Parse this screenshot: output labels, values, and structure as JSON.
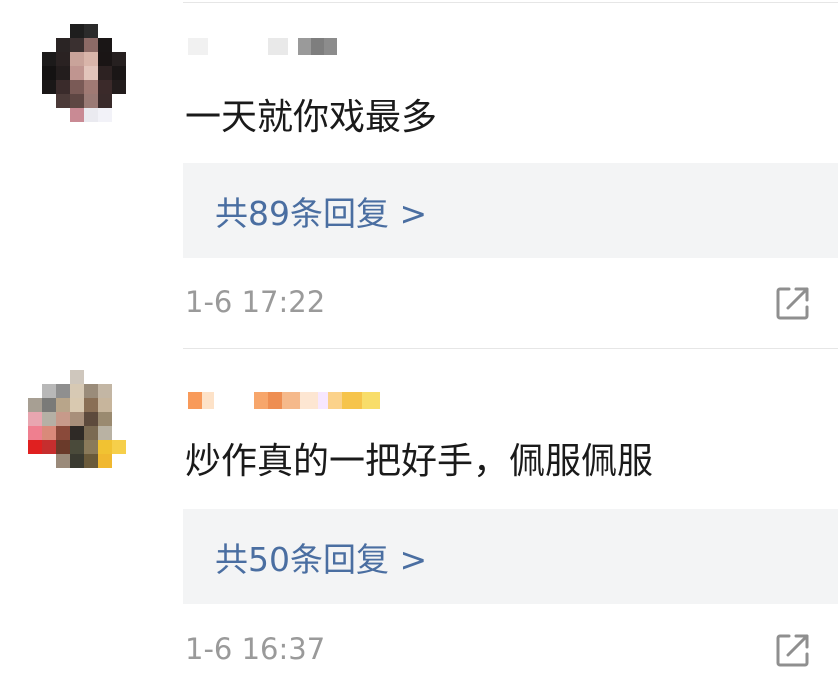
{
  "comments": [
    {
      "text": "一天就你戏最多",
      "reply_label": "共89条回复 >",
      "timestamp": "1-6 17:22",
      "avatar_icon": "pixelated-avatar-icon",
      "share_icon": "share-external-icon"
    },
    {
      "text": "炒作真的一把好手，佩服佩服",
      "reply_label": "共50条回复 >",
      "timestamp": "1-6 16:37",
      "avatar_icon": "pixelated-avatar-icon",
      "share_icon": "share-external-icon"
    }
  ],
  "colors": {
    "reply_link": "#4a6ea1",
    "reply_background": "#f3f4f5",
    "timestamp": "#9a9a9a",
    "comment_text": "#1a1a1a"
  }
}
